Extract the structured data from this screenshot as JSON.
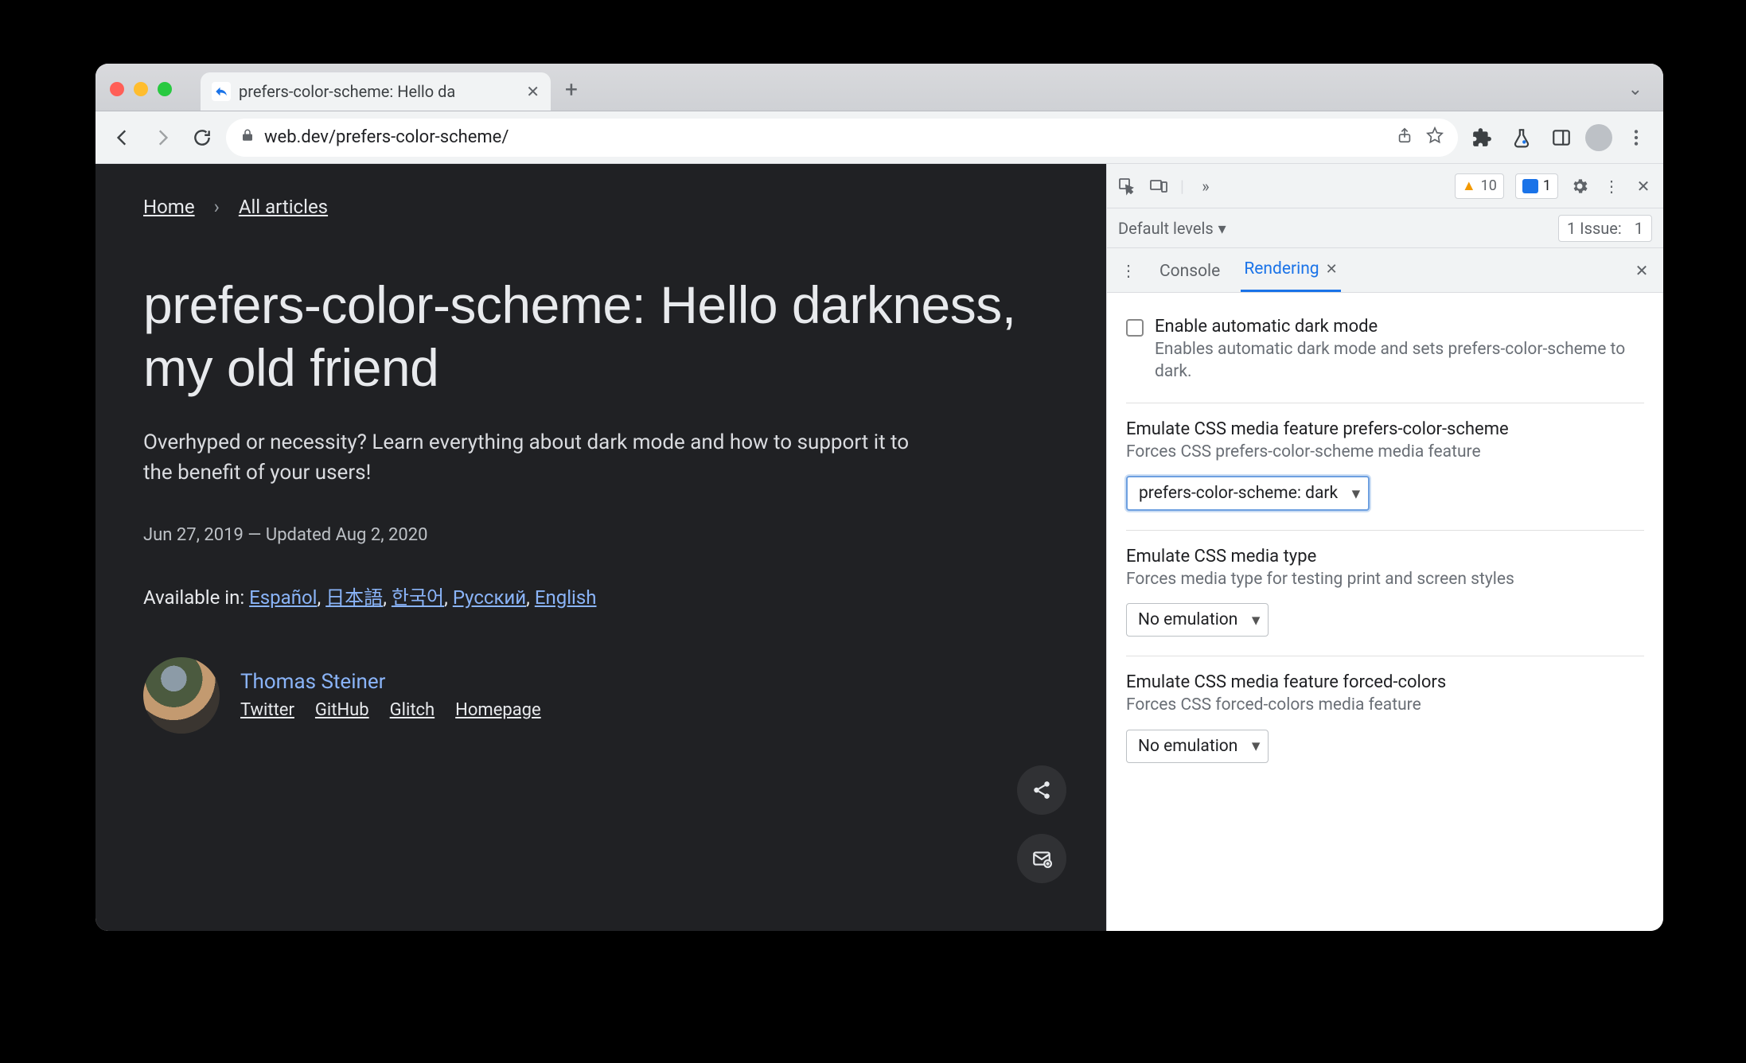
{
  "window": {
    "tab_title": "prefers-color-scheme: Hello da",
    "url_display": "web.dev/prefers-color-scheme/"
  },
  "page": {
    "breadcrumbs": {
      "home": "Home",
      "all": "All articles"
    },
    "title": "prefers-color-scheme: Hello darkness, my old friend",
    "subhead": "Overhyped or necessity? Learn everything about dark mode and how to support it to the benefit of your users!",
    "dates": "Jun 27, 2019 — Updated Aug 2, 2020",
    "available_in_label": "Available in:",
    "languages": {
      "es": "Español",
      "ja": "日本語",
      "ko": "한국어",
      "ru": "Русский",
      "en": "English"
    },
    "author": {
      "name": "Thomas Steiner",
      "links": {
        "twitter": "Twitter",
        "github": "GitHub",
        "glitch": "Glitch",
        "homepage": "Homepage"
      }
    }
  },
  "devtools": {
    "warnings_count": "10",
    "errors_count": "1",
    "default_levels": "Default levels",
    "issues_label": "1 Issue:",
    "issues_count": "1",
    "tabs": {
      "console": "Console",
      "rendering": "Rendering"
    },
    "sections": {
      "autodark": {
        "title": "Enable automatic dark mode",
        "desc": "Enables automatic dark mode and sets prefers-color-scheme to dark."
      },
      "pcs": {
        "title": "Emulate CSS media feature prefers-color-scheme",
        "desc": "Forces CSS prefers-color-scheme media feature",
        "value": "prefers-color-scheme: dark"
      },
      "mediatype": {
        "title": "Emulate CSS media type",
        "desc": "Forces media type for testing print and screen styles",
        "value": "No emulation"
      },
      "forcedcolors": {
        "title": "Emulate CSS media feature forced-colors",
        "desc": "Forces CSS forced-colors media feature",
        "value": "No emulation"
      }
    }
  }
}
